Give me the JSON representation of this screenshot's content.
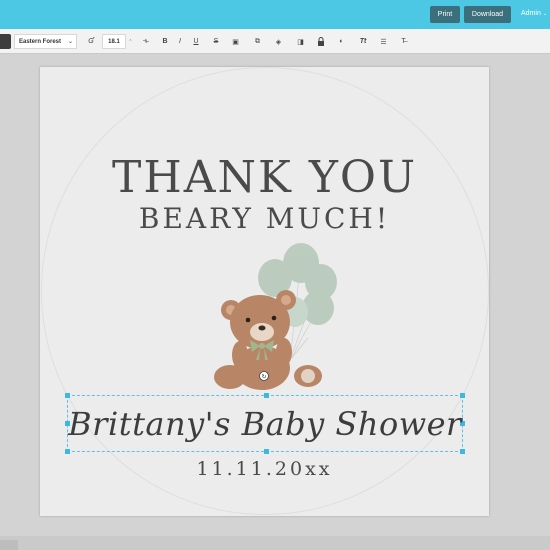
{
  "topbar": {
    "print_label": "Print",
    "download_label": "Download",
    "admin_label": "Admin",
    "accent_color": "#4dc8e4",
    "button_color": "#3b6f7c"
  },
  "toolbar": {
    "font_name": "Eastern Forest",
    "font_size": "18.1",
    "tools": [
      {
        "icon": "font-style-icon",
        "glyph": "Ɠ"
      },
      {
        "icon": "letter-spacing-icon",
        "glyph": "⟛"
      },
      {
        "icon": "bold-icon",
        "glyph": "B"
      },
      {
        "icon": "italic-icon",
        "glyph": "I"
      },
      {
        "icon": "underline-icon",
        "glyph": "U"
      },
      {
        "icon": "strikethrough-icon",
        "glyph": "S"
      },
      {
        "icon": "image-icon",
        "glyph": "▣"
      },
      {
        "icon": "copy-icon",
        "glyph": "⧉"
      },
      {
        "icon": "layers-icon",
        "glyph": "◈"
      },
      {
        "icon": "shadow-icon",
        "glyph": "◨"
      },
      {
        "icon": "lock-icon",
        "glyph": "🔒"
      },
      {
        "icon": "color-icon",
        "glyph": "◐"
      },
      {
        "icon": "text-transform-icon",
        "glyph": "Tt"
      },
      {
        "icon": "line-height-icon",
        "glyph": "☰"
      },
      {
        "icon": "clear-format-icon",
        "glyph": "T̶"
      }
    ]
  },
  "design": {
    "headline": "THANK YOU",
    "subheadline": "BEARY MUCH!",
    "script_line": "Brittany's Baby Shower",
    "date_line": "11.11.20xx",
    "balloon_color": "#b9cbbd",
    "bear_color": "#b98567"
  }
}
